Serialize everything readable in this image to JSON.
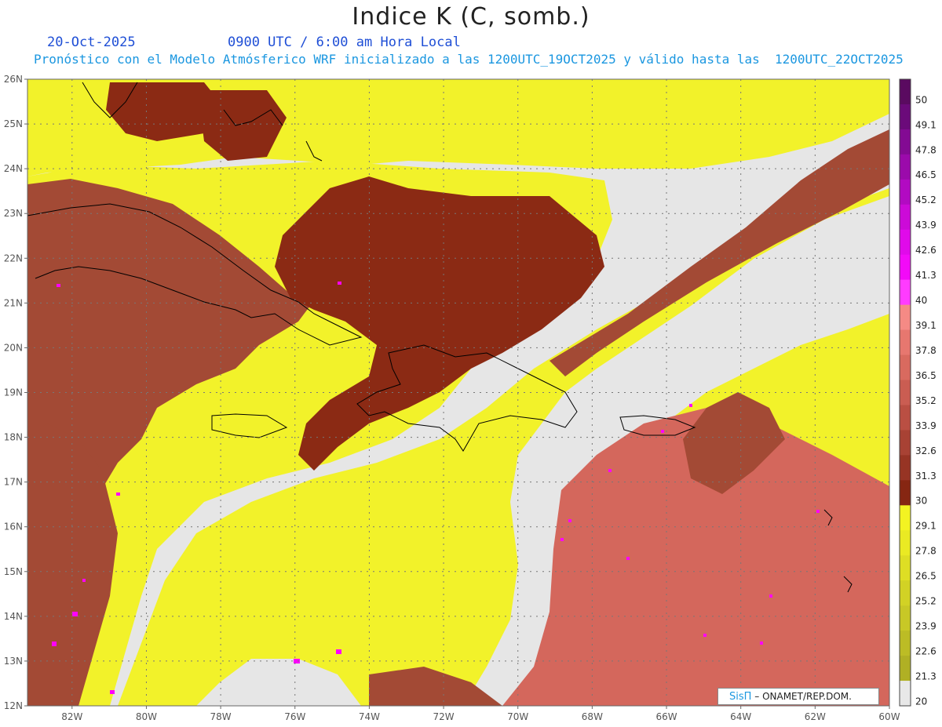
{
  "header": {
    "title": "Indice K (C, somb.)",
    "date": "20-Oct-2025",
    "time": "0900 UTC / 6:00 am Hora Local",
    "description": "Pronóstico con el Modelo Atmósferico WRF inicializado a las 1200UTC_19OCT2025 y válido hasta las  1200UTC_22OCT2025"
  },
  "map": {
    "lat_labels": [
      "26N",
      "25N",
      "24N",
      "23N",
      "22N",
      "21N",
      "20N",
      "19N",
      "18N",
      "17N",
      "16N",
      "15N",
      "14N",
      "13N",
      "12N"
    ],
    "lon_labels": [
      "82W",
      "80W",
      "78W",
      "76W",
      "74W",
      "72W",
      "70W",
      "68W",
      "66W",
      "64W",
      "62W",
      "60W"
    ],
    "lat_range": [
      12,
      26
    ],
    "lon_range": [
      -83.2,
      -60
    ],
    "grid": true,
    "colors": {
      "background_low": "#e6e6e6",
      "yellow": "#f2f22a",
      "brown_dark": "#8b2a14",
      "brown_mid": "#a34a35",
      "salmon": "#d4675c",
      "magenta": "#ff00ff",
      "coast": "#000000"
    }
  },
  "colorbar": {
    "labels": [
      "50",
      "49.1",
      "47.8",
      "46.5",
      "45.2",
      "43.9",
      "42.6",
      "41.3",
      "40",
      "39.1",
      "37.8",
      "36.5",
      "35.2",
      "33.9",
      "32.6",
      "31.3",
      "30",
      "29.1",
      "27.8",
      "26.5",
      "25.2",
      "23.9",
      "22.6",
      "21.3",
      "20"
    ],
    "colors": [
      "#5a0a60",
      "#6b0a7a",
      "#830a93",
      "#9b0aab",
      "#b20ac2",
      "#cc0ad8",
      "#e00aea",
      "#f20af8",
      "#ff3bff",
      "#f58a85",
      "#e7776f",
      "#d96a5f",
      "#ca5d52",
      "#ba4f43",
      "#a84234",
      "#973424",
      "#862612",
      "#f3f322",
      "#eaea23",
      "#dede24",
      "#d2d225",
      "#c8c826",
      "#bcbc25",
      "#b0b024",
      "#e8e8e8"
    ]
  },
  "credit": {
    "brand": "SisΠ",
    "text": "–  ONAMET/REP.DOM."
  }
}
